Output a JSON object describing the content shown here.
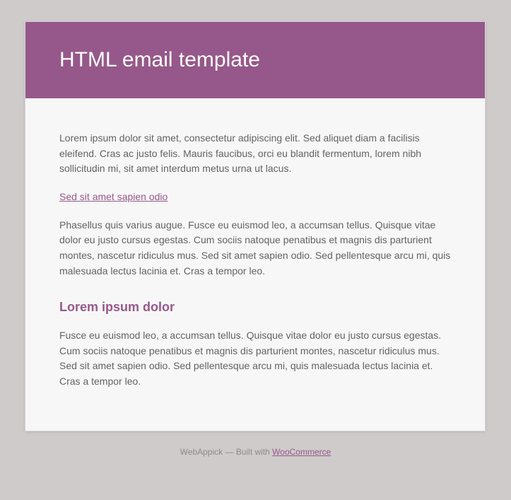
{
  "colors": {
    "background": "#cfcbcb",
    "card_bg": "#f7f7f7",
    "header_bg": "#96588a",
    "header_text": "#ffffff",
    "body_text": "#636363",
    "accent": "#96588a",
    "footer_text": "#8a8a8a"
  },
  "header": {
    "title": "HTML email template"
  },
  "body": {
    "para1": "Lorem ipsum dolor sit amet, consectetur adipiscing elit. Sed aliquet diam a facilisis eleifend. Cras ac justo felis. Mauris faucibus, orci eu blandit fermentum, lorem nibh sollicitudin mi, sit amet interdum metus urna ut lacus.",
    "link1": "Sed sit amet sapien odio",
    "para2": "Phasellus quis varius augue. Fusce eu euismod leo, a accumsan tellus. Quisque vitae dolor eu justo cursus egestas. Cum sociis natoque penatibus et magnis dis parturient montes, nascetur ridiculus mus. Sed sit amet sapien odio. Sed pellentesque arcu mi, quis malesuada lectus lacinia et. Cras a tempor leo.",
    "heading2": "Lorem ipsum dolor",
    "para3": "Fusce eu euismod leo, a accumsan tellus. Quisque vitae dolor eu justo cursus egestas. Cum sociis natoque penatibus et magnis dis parturient montes, nascetur ridiculus mus. Sed sit amet sapien odio. Sed pellentesque arcu mi, quis malesuada lectus lacinia et. Cras a tempor leo."
  },
  "footer": {
    "prefix": "WebAppick — Built with ",
    "link_label": "WooCommerce"
  }
}
